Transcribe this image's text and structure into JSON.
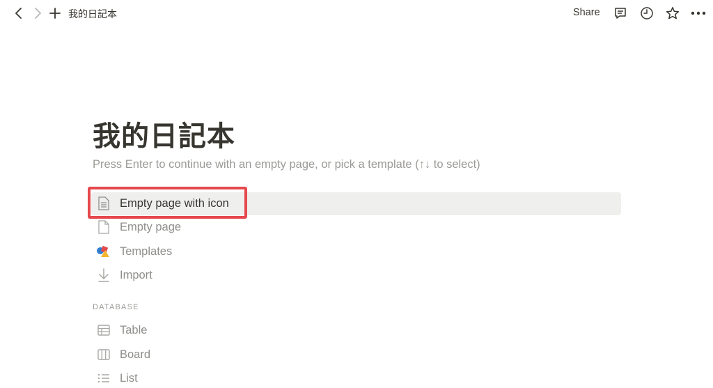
{
  "topbar": {
    "breadcrumb": "我的日記本",
    "share_label": "Share",
    "icons": [
      "back-icon",
      "forward-icon",
      "plus-icon",
      "comment-icon",
      "history-icon",
      "star-icon",
      "more-icon"
    ]
  },
  "page": {
    "title": "我的日記本",
    "hint": "Press Enter to continue with an empty page, or pick a template (↑↓ to select)"
  },
  "options": [
    {
      "label": "Empty page with icon",
      "icon": "page-with-icon-icon",
      "active": true
    },
    {
      "label": "Empty page",
      "icon": "page-icon"
    },
    {
      "label": "Templates",
      "icon": "templates-icon"
    },
    {
      "label": "Import",
      "icon": "import-icon"
    }
  ],
  "database": {
    "heading": "DATABASE",
    "items": [
      {
        "label": "Table",
        "icon": "table-icon"
      },
      {
        "label": "Board",
        "icon": "board-icon"
      },
      {
        "label": "List",
        "icon": "list-icon"
      }
    ]
  },
  "colors": {
    "highlight_border": "#e5484d",
    "row_highlight": "#efefee",
    "text": "#37352f",
    "muted": "#9b9a97"
  }
}
